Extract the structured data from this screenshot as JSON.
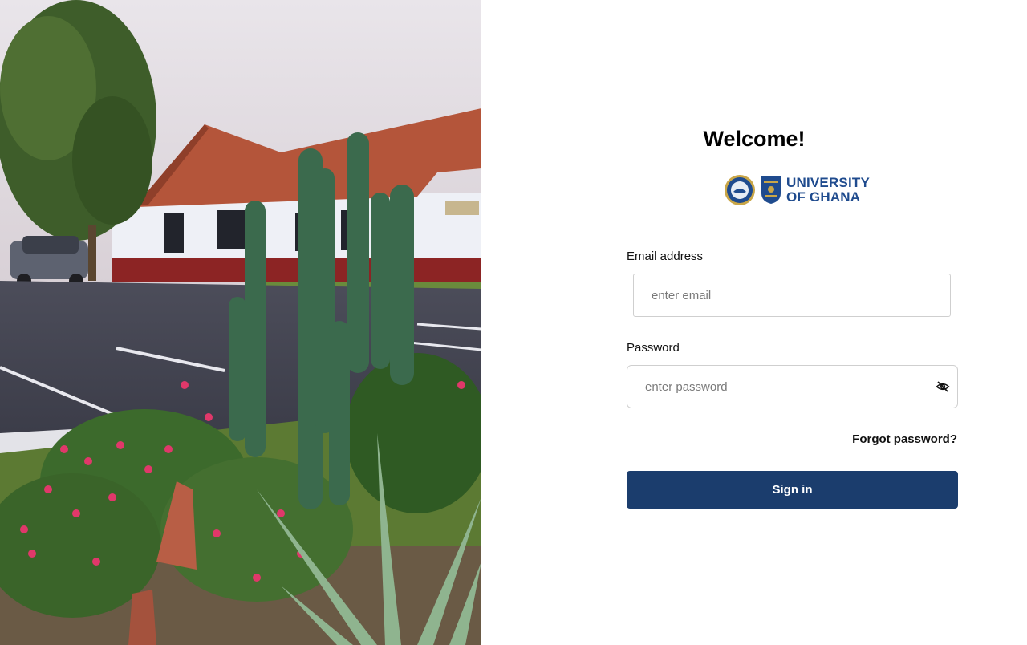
{
  "welcome_title": "Welcome!",
  "logo": {
    "line1": "UNIVERSITY",
    "line2": "OF GHANA",
    "brand_color": "#1f4b8e"
  },
  "form": {
    "email_label": "Email address",
    "email_placeholder": "enter email",
    "email_value": "",
    "password_label": "Password",
    "password_placeholder": "enter password",
    "password_value": "",
    "password_toggle_icon": "eye-off-icon",
    "forgot_label": "Forgot password?",
    "signin_label": "Sign in"
  },
  "colors": {
    "primary_button": "#1b3d6d",
    "border": "#cfcfcf"
  }
}
